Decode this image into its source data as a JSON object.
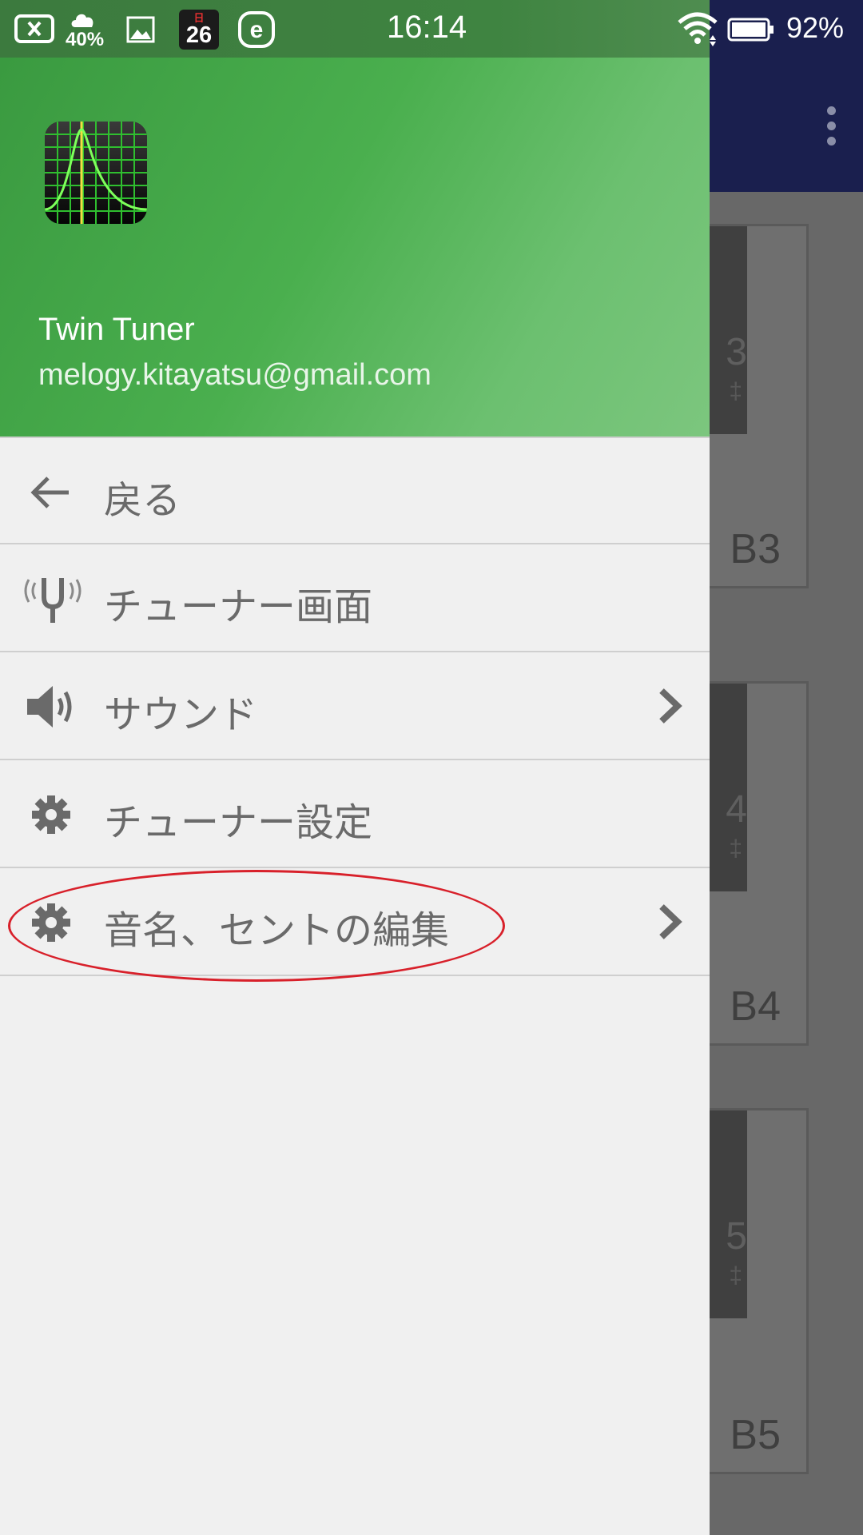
{
  "status_bar": {
    "time": "16:14",
    "weather_percent": "40%",
    "calendar_day_label": "日",
    "calendar_date": "26",
    "battery": "92%",
    "icons": [
      "cancel-box-icon",
      "cloud-icon",
      "image-icon",
      "calendar-icon",
      "e-app-icon",
      "wifi-icon",
      "battery-icon"
    ]
  },
  "drawer": {
    "header": {
      "app_name": "Twin Tuner",
      "email": "melogy.kitayatsu@gmail.com"
    },
    "items": [
      {
        "label": "戻る",
        "icon": "arrow-back-icon",
        "chevron": false
      },
      {
        "label": "チューナー画面",
        "icon": "tuning-fork-icon",
        "chevron": false
      },
      {
        "label": "サウンド",
        "icon": "speaker-icon",
        "chevron": true
      },
      {
        "label": "チューナー設定",
        "icon": "gear-icon",
        "chevron": false
      },
      {
        "label": "音名、セントの編集",
        "icon": "gear-icon",
        "chevron": true
      }
    ]
  },
  "background": {
    "notes": [
      {
        "main": "3",
        "sub": "‡",
        "label": "B3"
      },
      {
        "main": "4",
        "sub": "‡",
        "label": "B4"
      },
      {
        "main": "5",
        "sub": "‡",
        "label": "B5"
      }
    ]
  },
  "colors": {
    "header_green": "#4aaf4e",
    "appbar_navy": "#1a1f4e",
    "highlight_red": "#d8202a"
  }
}
